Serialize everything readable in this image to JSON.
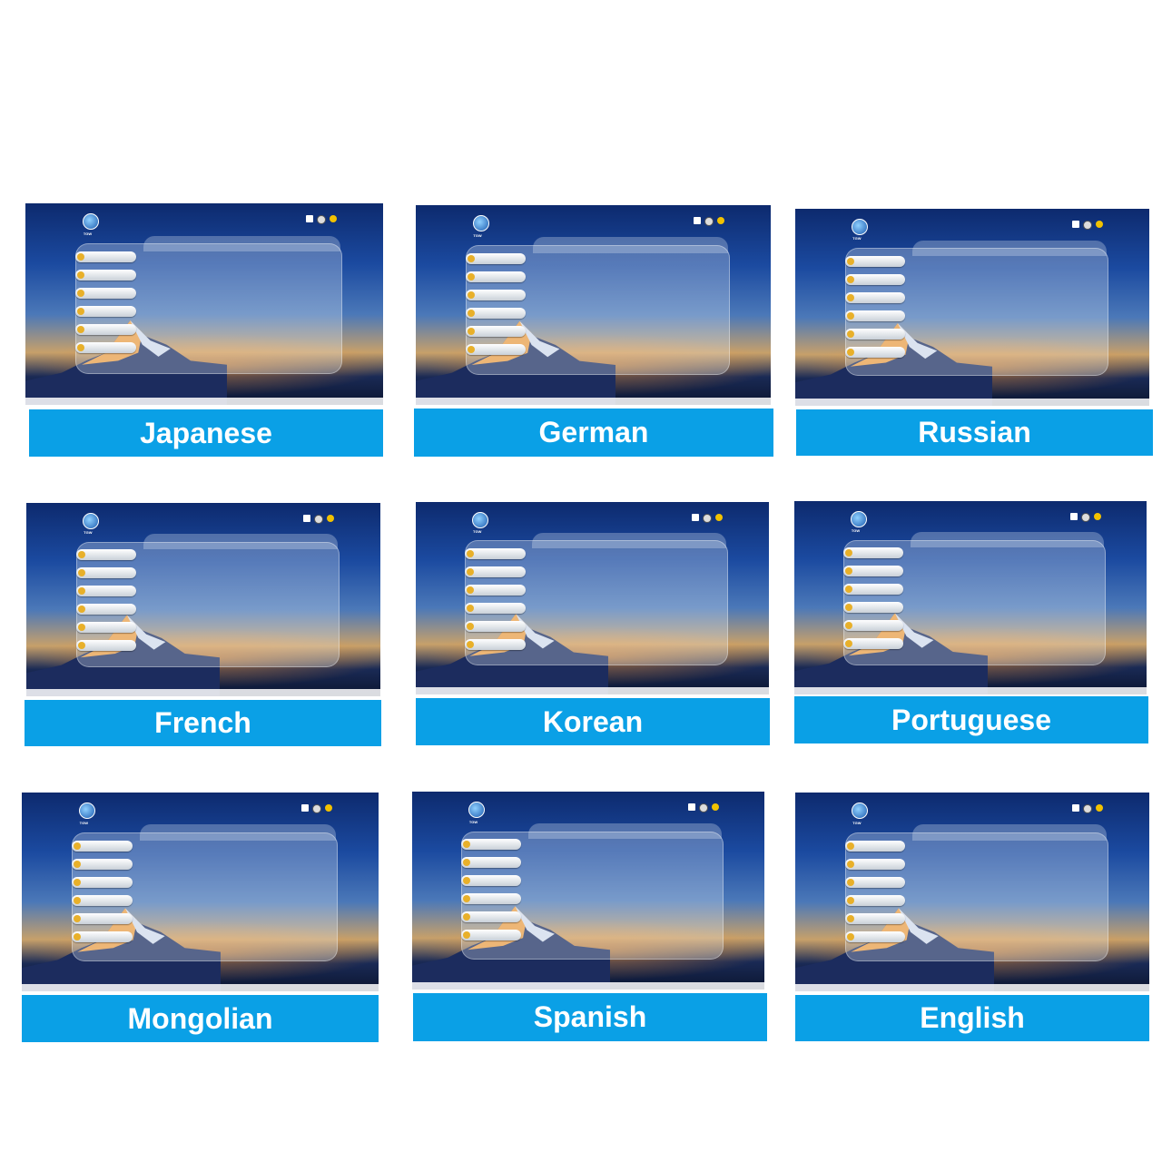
{
  "cards": [
    {
      "label": "Japanese"
    },
    {
      "label": "German"
    },
    {
      "label": "Russian"
    },
    {
      "label": "French"
    },
    {
      "label": "Korean"
    },
    {
      "label": "Portuguese"
    },
    {
      "label": "Mongolian"
    },
    {
      "label": "Spanish"
    },
    {
      "label": "English"
    }
  ],
  "logo_text": "TGW",
  "colors": {
    "label_bg": "#0aa0e6",
    "label_text": "#ffffff",
    "title_text": "#f0a030"
  },
  "icons": [
    "logo-icon",
    "user-icon",
    "settings-icon",
    "info-icon",
    "menu-item-icon"
  ]
}
